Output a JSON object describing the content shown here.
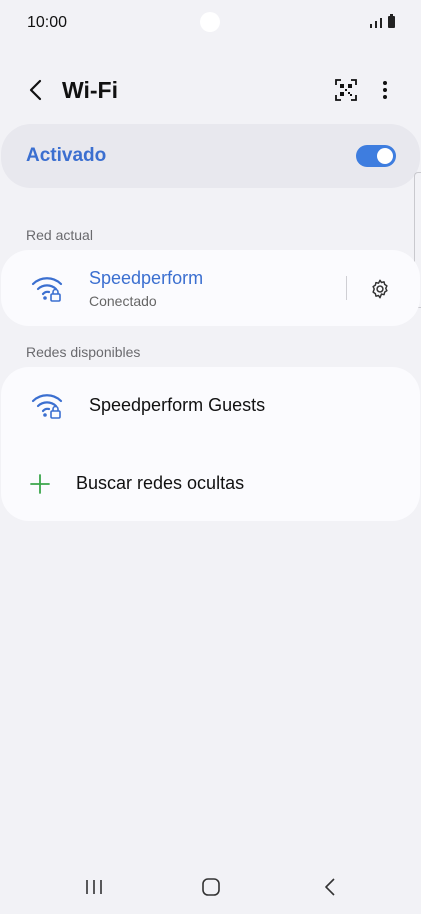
{
  "status_bar": {
    "time": "10:00"
  },
  "header": {
    "title": "Wi-Fi",
    "back_icon": "chevron-left-icon",
    "qr_icon": "qr-code-scan-icon",
    "more_icon": "more-vertical-icon"
  },
  "master_switch": {
    "label": "Activado",
    "state": "on",
    "accent_color": "#3b6fd0"
  },
  "current_network": {
    "section_label": "Red actual",
    "name": "Speedperform",
    "status": "Conectado",
    "icon": "wifi-lock-icon",
    "settings_icon": "gear-icon"
  },
  "available_networks": {
    "section_label": "Redes disponibles",
    "items": [
      {
        "name": "Speedperform Guests",
        "icon": "wifi-lock-icon"
      }
    ],
    "hidden_networks_label": "Buscar redes ocultas",
    "hidden_icon": "plus-icon"
  },
  "nav_bar": {
    "recents_icon": "recents-icon",
    "home_icon": "home-icon",
    "back_icon": "back-icon"
  }
}
